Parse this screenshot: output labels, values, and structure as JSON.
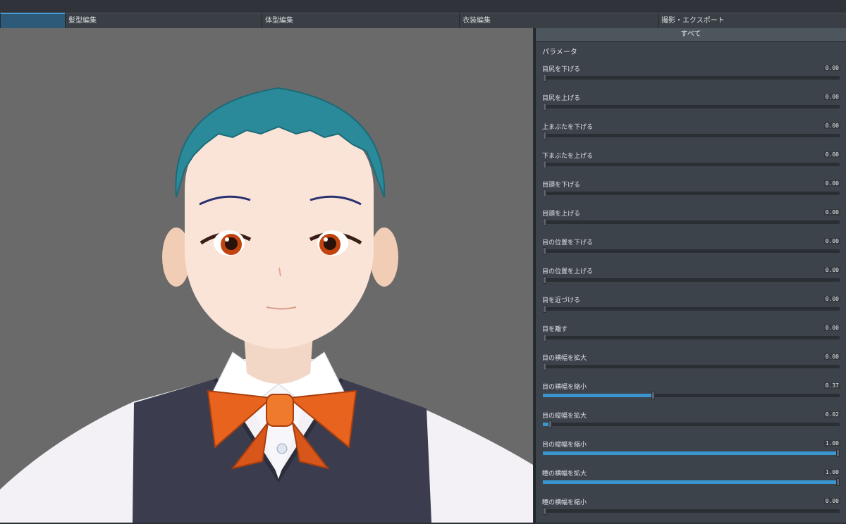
{
  "tabs": [
    {
      "label": ""
    },
    {
      "label": "髪型編集"
    },
    {
      "label": "体型編集"
    },
    {
      "label": "衣装編集"
    },
    {
      "label": "撮影・エクスポート"
    }
  ],
  "panel": {
    "header": "すべて",
    "section_title": "パラメータ",
    "params": [
      {
        "label": "目尻を下げる",
        "value": "0.00",
        "level": 0.0
      },
      {
        "label": "目尻を上げる",
        "value": "0.00",
        "level": 0.0
      },
      {
        "label": "上まぶたを下げる",
        "value": "0.00",
        "level": 0.0
      },
      {
        "label": "下まぶたを上げる",
        "value": "0.00",
        "level": 0.0
      },
      {
        "label": "目頭を下げる",
        "value": "0.00",
        "level": 0.0
      },
      {
        "label": "目頭を上げる",
        "value": "0.00",
        "level": 0.0
      },
      {
        "label": "目の位置を下げる",
        "value": "0.00",
        "level": 0.0
      },
      {
        "label": "目の位置を上げる",
        "value": "0.00",
        "level": 0.0
      },
      {
        "label": "目を近づける",
        "value": "0.00",
        "level": 0.0
      },
      {
        "label": "目を離す",
        "value": "0.00",
        "level": 0.0
      },
      {
        "label": "目の横幅を拡大",
        "value": "0.00",
        "level": 0.0
      },
      {
        "label": "目の横幅を縮小",
        "value": "0.37",
        "level": 0.37
      },
      {
        "label": "目の縦幅を拡大",
        "value": "0.02",
        "level": 0.02
      },
      {
        "label": "目の縦幅を縮小",
        "value": "1.00",
        "level": 1.0
      },
      {
        "label": "瞳の横幅を拡大",
        "value": "1.00",
        "level": 1.0
      },
      {
        "label": "瞳の横幅を縮小",
        "value": "0.00",
        "level": 0.0
      }
    ]
  },
  "colors": {
    "accent": "#3a95cf",
    "hair": "#2a8a9a",
    "bow": "#e8641e",
    "vest": "#3b3d4e",
    "viewport_bg": "#6a6a6a"
  }
}
